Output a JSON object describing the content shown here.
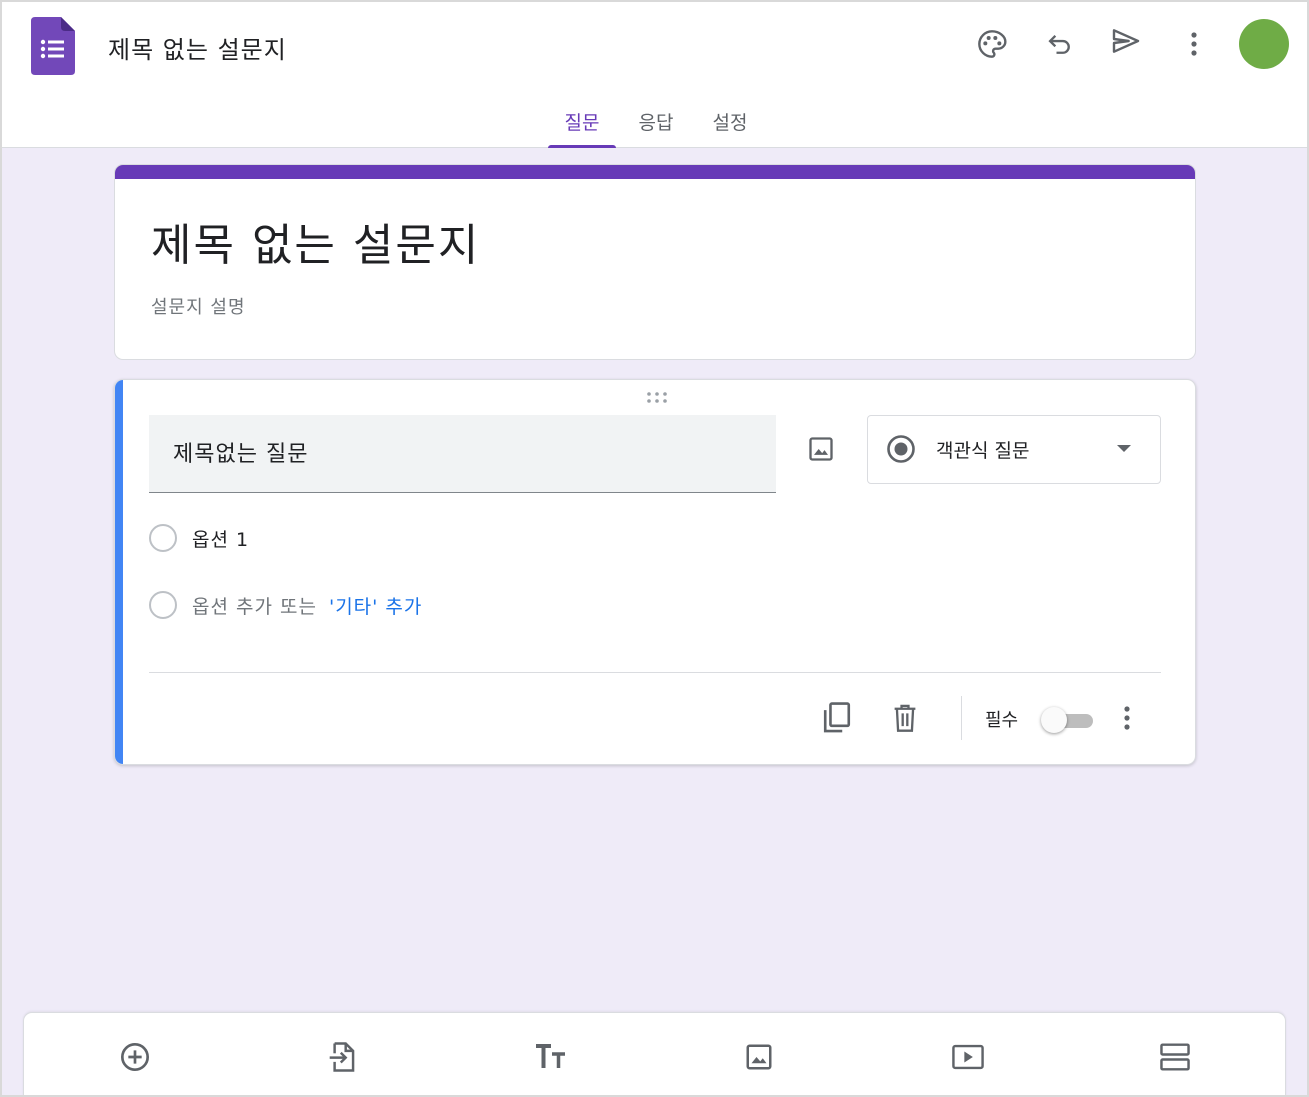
{
  "header": {
    "doc_title": "제목 없는 설문지",
    "icons": [
      "palette-icon",
      "undo-icon",
      "send-icon",
      "more-vert-icon"
    ],
    "avatar_color": "#6fac46",
    "tabs": [
      {
        "label": "질문",
        "active": true
      },
      {
        "label": "응답",
        "active": false
      },
      {
        "label": "설정",
        "active": false
      }
    ]
  },
  "form": {
    "title": "제목 없는 설문지",
    "description_placeholder": "설문지 설명",
    "accent_color": "#673ab7"
  },
  "question": {
    "title": "제목없는 질문",
    "type_label": "객관식 질문",
    "options": [
      "옵션 1"
    ],
    "add_option_label": "옵션 추가 또는",
    "add_other_label": "'기타' 추가",
    "required_label": "필수",
    "required": false,
    "active_bar_color": "#4285f4"
  },
  "toolbar": {
    "icons": [
      "add-question-icon",
      "import-questions-icon",
      "add-title-icon",
      "add-image-icon",
      "add-video-icon",
      "add-section-icon"
    ]
  }
}
